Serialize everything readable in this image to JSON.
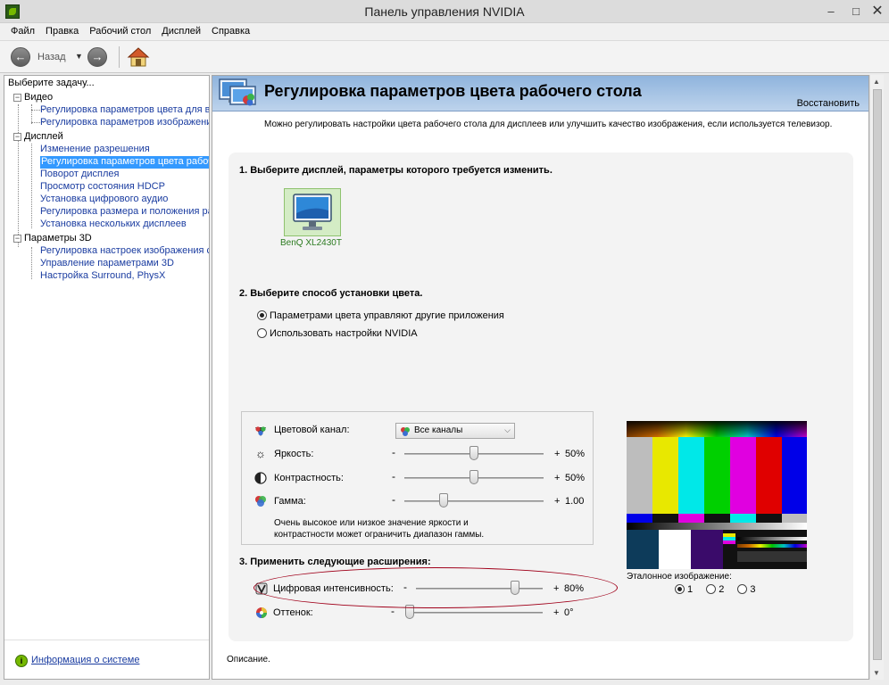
{
  "window": {
    "title": "Панель управления NVIDIA"
  },
  "menu": [
    "Файл",
    "Правка",
    "Рабочий стол",
    "Дисплей",
    "Справка"
  ],
  "toolbar": {
    "back_label": "Назад"
  },
  "sidebar": {
    "heading": "Выберите задачу...",
    "categories": [
      {
        "label": "Видео",
        "items": [
          "Регулировка параметров цвета для вид",
          "Регулировка параметров изображения д"
        ]
      },
      {
        "label": "Дисплей",
        "items": [
          "Изменение разрешения",
          "Регулировка параметров цвета рабочег",
          "Поворот дисплея",
          "Просмотр состояния HDCP",
          "Установка цифрового аудио",
          "Регулировка размера и положения рабо",
          "Установка нескольких дисплеев"
        ]
      },
      {
        "label": "Параметры 3D",
        "items": [
          "Регулировка настроек изображения с пр",
          "Управление параметрами 3D",
          "Настройка Surround, PhysX"
        ]
      }
    ],
    "selected_item": "Регулировка параметров цвета рабочег",
    "footer_link": "Информация о системе"
  },
  "page": {
    "title": "Регулировка параметров цвета рабочего стола",
    "restore": "Восстановить",
    "description": "Можно регулировать настройки цвета рабочего стола для дисплеев или улучшить качество изображения, если используется телевизор.",
    "step1": "1. Выберите дисплей, параметры которого требуется изменить.",
    "display_name": "BenQ XL2430T",
    "step2": "2. Выберите способ установки цвета.",
    "radio_other_apps": "Параметрами цвета управляют другие приложения",
    "radio_nvidia": "Использовать настройки NVIDIA",
    "channel_label": "Цветовой канал:",
    "channel_value": "Все каналы",
    "brightness": {
      "label": "Яркость:",
      "value": "50%",
      "level": 0.5
    },
    "contrast": {
      "label": "Контрастность:",
      "value": "50%",
      "level": 0.5
    },
    "gamma": {
      "label": "Гамма:",
      "value": "1.00",
      "level": 0.27
    },
    "note": "Очень высокое или низкое значение яркости и контрастности может ограничить диапазон гаммы.",
    "step3": "3. Применить следующие расширения:",
    "digital_vibrance": {
      "label": "Цифровая интенсивность:",
      "value": "80%",
      "level": 0.8
    },
    "hue": {
      "label": "Оттенок:",
      "value": "0°",
      "level": 0.0
    },
    "reference_label": "Эталонное изображение:",
    "reference_options": [
      "1",
      "2",
      "3"
    ],
    "description_label": "Описание."
  },
  "colors": {
    "nvidia_green": "#76b900",
    "banner_top": "#8fb4dd",
    "selection": "#3399ff",
    "highlight_ellipse": "#a0001a"
  }
}
